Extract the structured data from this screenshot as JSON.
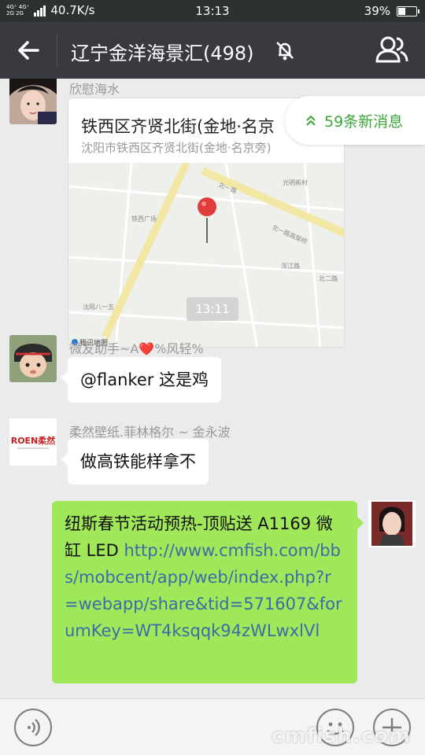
{
  "status_bar": {
    "network_top": "4G⁺ 4G⁺",
    "network_bottom": "2G  2G",
    "speed": "40.7K/s",
    "time": "13:13",
    "battery_text": "39%",
    "battery_level": 0.39
  },
  "header": {
    "title": "辽宁金洋海景汇(498)"
  },
  "messages": {
    "m1": {
      "sender": "欣慰海水",
      "map_title": "铁西区齐贤北街(金地·名京",
      "map_address": "沈阳市铁西区齐贤北街(金地·名京旁)",
      "map_logo": "腾讯地图",
      "map_labels": [
        "北一路",
        "光明新村",
        "北一路高架桥",
        "浑江路",
        "沈阳八一五",
        "铁西广场",
        "北二路"
      ]
    },
    "new_messages": "59条新消息",
    "timestamp": "13:11",
    "m2": {
      "sender": "微友助手~A❤️%风轻%",
      "text": "@flanker  这是鸡"
    },
    "m3": {
      "sender": "柔然壁纸.菲林格尔 ~ 金永波",
      "avatar_logo": "ROEN柔然",
      "text": "做高铁能样拿不"
    },
    "m4": {
      "text_prefix": "纽斯春节活动预热-顶贴送 A1169 微缸 LED ",
      "link": "http://www.cmfish.com/bbs/mobcent/app/web/index.php?r=webapp/share&tid=571607&forumKey=WT4ksqqk94zWLwxlVl"
    }
  },
  "watermark": "cmfish.com",
  "colors": {
    "header_bg": "#393a3f",
    "statusbar_bg": "#2e3132",
    "sent_bubble": "#a0e75a",
    "chat_bg": "#ebebeb",
    "new_msg_green": "#3aa63a",
    "link_blue": "#3a6ca8"
  }
}
